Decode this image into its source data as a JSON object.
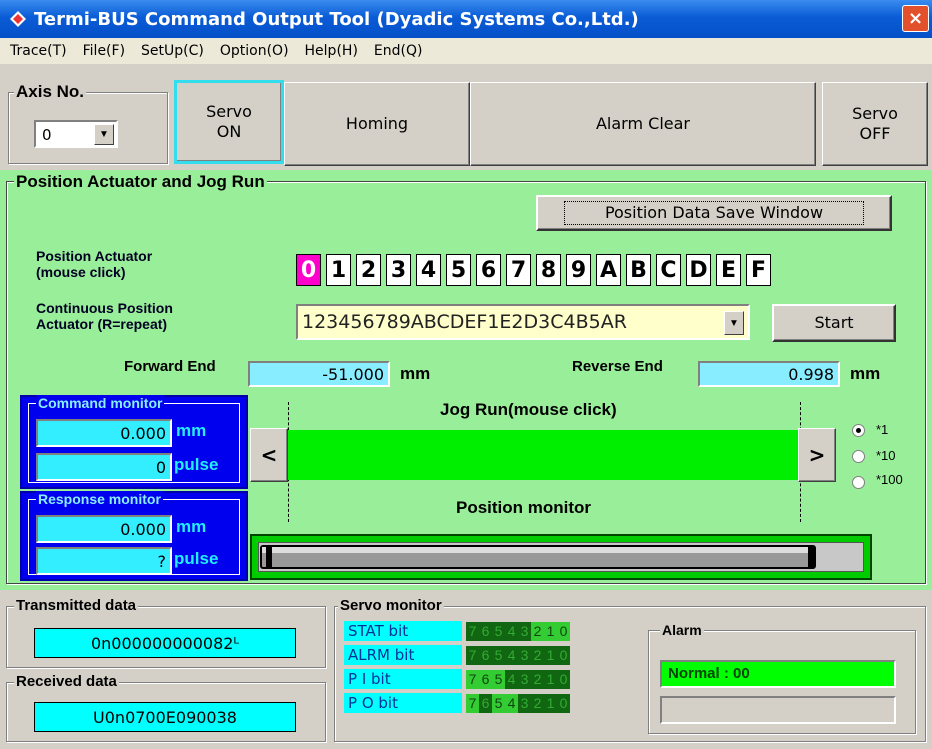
{
  "window": {
    "title": "Termi-BUS Command Output Tool (Dyadic Systems Co.,Ltd.)",
    "close": "×"
  },
  "menu": [
    "Trace(T)",
    "File(F)",
    "SetUp(C)",
    "Option(O)",
    "Help(H)",
    "End(Q)"
  ],
  "axis": {
    "label": "Axis No.",
    "value": "0",
    "arrow": "▼"
  },
  "toolbar": {
    "servo_on_1": "Servo",
    "servo_on_2": "ON",
    "homing": "Homing",
    "alarm_clear": "Alarm Clear",
    "servo_off_1": "Servo",
    "servo_off_2": "OFF"
  },
  "panel": {
    "title": "Position Actuator and Jog Run",
    "save_window": "Position Data Save Window",
    "pa_label_1": "Position Actuator",
    "pa_label_2": "(mouse click)",
    "pa_cells": [
      "0",
      "1",
      "2",
      "3",
      "4",
      "5",
      "6",
      "7",
      "8",
      "9",
      "A",
      "B",
      "C",
      "D",
      "E",
      "F"
    ],
    "cpa_label_1": "Continuous Position",
    "cpa_label_2": "Actuator  (R=repeat)",
    "cpa_value": "123456789ABCDEF1E2D3C4B5AR",
    "start": "Start",
    "forward_end_label": "Forward End",
    "forward_end_value": "-51.000",
    "reverse_end_label": "Reverse End",
    "reverse_end_value": "0.998",
    "mm": "mm",
    "jog_label": "Jog Run(mouse click)",
    "jog_left": "<",
    "jog_right": ">",
    "position_monitor": "Position monitor",
    "radios": [
      "*1",
      "*10",
      "*100"
    ]
  },
  "command_monitor": {
    "title": "Command monitor",
    "mm_value": "0.000",
    "pulse_value": "0",
    "mm": "mm",
    "pulse": "pulse"
  },
  "response_monitor": {
    "title": "Response monitor",
    "mm_value": "0.000",
    "pulse_value": "?",
    "mm": "mm",
    "pulse": "pulse"
  },
  "transmitted": {
    "title": "Transmitted data",
    "value": "0n000000000082ᴸ"
  },
  "received": {
    "title": "Received data",
    "value": "U0n0700E090038"
  },
  "servo_monitor": {
    "title": "Servo monitor",
    "rows": [
      {
        "label": "STAT  bit",
        "bits": [
          "7",
          "6",
          "5",
          "4",
          "3",
          "2",
          "1",
          "0"
        ],
        "on": [
          0,
          0,
          0,
          0,
          0,
          1,
          1,
          1
        ]
      },
      {
        "label": "ALRM  bit",
        "bits": [
          "7",
          "6",
          "5",
          "4",
          "3",
          "2",
          "1",
          "0"
        ],
        "on": [
          0,
          0,
          0,
          0,
          0,
          0,
          0,
          0
        ]
      },
      {
        "label": " P I   bit",
        "bits": [
          "7",
          "6",
          "5",
          "4",
          "3",
          "2",
          "1",
          "0"
        ],
        "on": [
          1,
          1,
          1,
          0,
          0,
          0,
          0,
          0
        ]
      },
      {
        "label": " P O   bit",
        "bits": [
          "7",
          "6",
          "5",
          "4",
          "3",
          "2",
          "1",
          "0"
        ],
        "on": [
          1,
          0,
          1,
          1,
          0,
          0,
          0,
          0
        ]
      }
    ]
  },
  "alarm": {
    "title": "Alarm",
    "value": "Normal : 00",
    "extra": ""
  },
  "colors": {
    "panel_green": "#99ee99",
    "monitor_blue": "#0000ee",
    "cyan_field": "#88eeff",
    "selected_cell": "#ff00cc",
    "alarm_green": "#00ff00"
  }
}
